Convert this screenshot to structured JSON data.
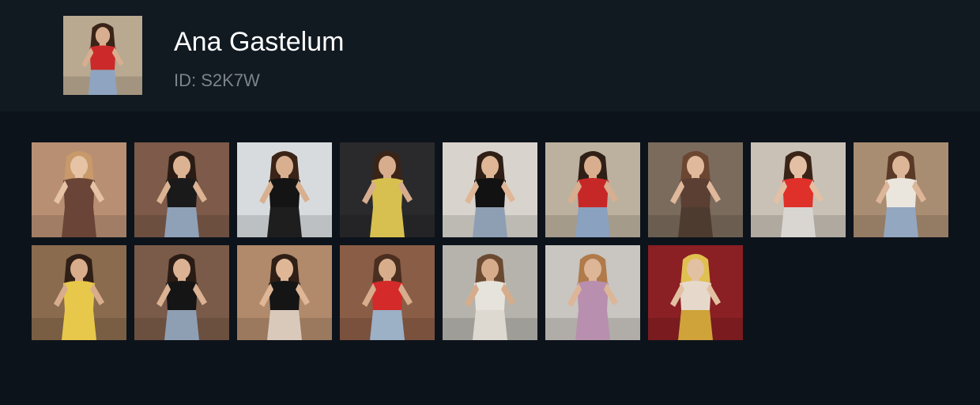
{
  "profile": {
    "name": "Ana Gastelum",
    "id_label": "ID: S2K7W",
    "avatar": {
      "bg": "#b9a990",
      "accent": "#cc2a2a",
      "bottom": "#8fa4c0",
      "skin": "#d8ae90",
      "hair": "#3a2418"
    }
  },
  "videos": [
    {
      "bg": "#b98f73",
      "accent": "#6a4436",
      "bottom": "#6a4436",
      "skin": "#e6c3a5",
      "hair": "#c89a6a"
    },
    {
      "bg": "#7d5a49",
      "accent": "#1a1a1a",
      "bottom": "#8fa1b7",
      "skin": "#dcb392",
      "hair": "#2a1c14"
    },
    {
      "bg": "#d8dbdd",
      "accent": "#141414",
      "bottom": "#1e1e1e",
      "skin": "#d9b08f",
      "hair": "#3a2418"
    },
    {
      "bg": "#2a2a2d",
      "accent": "#d8c050",
      "bottom": "#d8c050",
      "skin": "#d7ad8e",
      "hair": "#3a2418"
    },
    {
      "bg": "#d8d3cc",
      "accent": "#121212",
      "bottom": "#8e9fb4",
      "skin": "#dfb696",
      "hair": "#2f1f16"
    },
    {
      "bg": "#bcb19f",
      "accent": "#c62828",
      "bottom": "#8aa1bf",
      "skin": "#d9ae8e",
      "hair": "#2f1f16"
    },
    {
      "bg": "#7a6b5d",
      "accent": "#5b3f33",
      "bottom": "#4e3b30",
      "skin": "#e0b89b",
      "hair": "#6b4630"
    },
    {
      "bg": "#c9c1b6",
      "accent": "#e0302a",
      "bottom": "#d9d6d2",
      "skin": "#e3c0a4",
      "hair": "#3a2418"
    },
    {
      "bg": "#a98d72",
      "accent": "#eae6dd",
      "bottom": "#93a7c0",
      "skin": "#ddb597",
      "hair": "#5a3a26"
    },
    {
      "bg": "#8a6b4e",
      "accent": "#e8c84a",
      "bottom": "#e8c84a",
      "skin": "#d8ad8c",
      "hair": "#2f1f16"
    },
    {
      "bg": "#7a5a48",
      "accent": "#151515",
      "bottom": "#8e9fb3",
      "skin": "#dbb293",
      "hair": "#2a1c14"
    },
    {
      "bg": "#b08a6b",
      "accent": "#151515",
      "bottom": "#d9c9bb",
      "skin": "#dfb797",
      "hair": "#2f1f16"
    },
    {
      "bg": "#8a5d46",
      "accent": "#d42a2a",
      "bottom": "#9cb0c6",
      "skin": "#d8ad8c",
      "hair": "#4a2e20"
    },
    {
      "bg": "#b6b3ac",
      "accent": "#e6e3dc",
      "bottom": "#ddd9d0",
      "skin": "#d7ac8b",
      "hair": "#6b4a32"
    },
    {
      "bg": "#c9c5c0",
      "accent": "#b88fae",
      "bottom": "#b88fae",
      "skin": "#ddb698",
      "hair": "#b07a4a"
    },
    {
      "bg": "#8a1f24",
      "accent": "#e6d9cc",
      "bottom": "#cfa33a",
      "skin": "#e2c1a3",
      "hair": "#e0c050"
    }
  ]
}
